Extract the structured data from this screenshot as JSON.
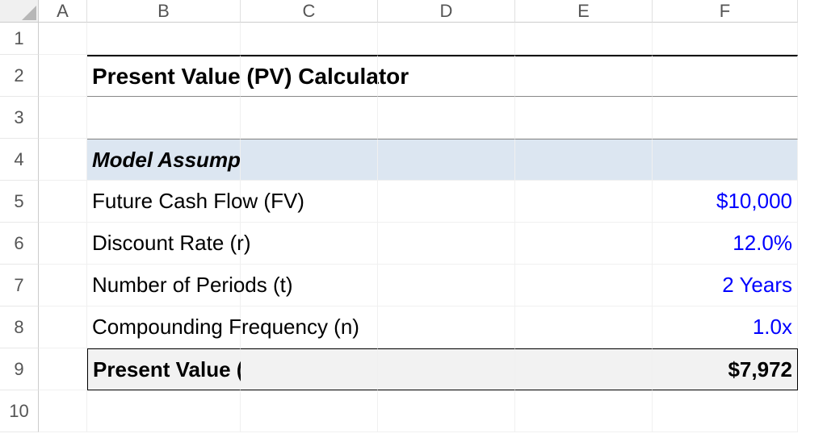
{
  "columns": [
    "A",
    "B",
    "C",
    "D",
    "E",
    "F"
  ],
  "rows": [
    "1",
    "2",
    "3",
    "4",
    "5",
    "6",
    "7",
    "8",
    "9",
    "10"
  ],
  "title": "Present Value (PV) Calculator",
  "section_header": "Model Assumptions",
  "assumptions": {
    "fv_label": "Future Cash Flow (FV)",
    "fv_value": "$10,000",
    "r_label": "Discount Rate (r)",
    "r_value": "12.0%",
    "t_label": "Number of Periods (t)",
    "t_value": "2 Years",
    "n_label": "Compounding Frequency (n)",
    "n_value": "1.0x"
  },
  "summary": {
    "label": "Present Value (PV)",
    "value": "$7,972"
  },
  "chart_data": {
    "type": "table",
    "title": "Present Value (PV) Calculator",
    "series": [
      {
        "name": "Future Cash Flow (FV)",
        "values": [
          "$10,000"
        ]
      },
      {
        "name": "Discount Rate (r)",
        "values": [
          "12.0%"
        ]
      },
      {
        "name": "Number of Periods (t)",
        "values": [
          "2 Years"
        ]
      },
      {
        "name": "Compounding Frequency (n)",
        "values": [
          "1.0x"
        ]
      },
      {
        "name": "Present Value (PV)",
        "values": [
          "$7,972"
        ]
      }
    ]
  }
}
